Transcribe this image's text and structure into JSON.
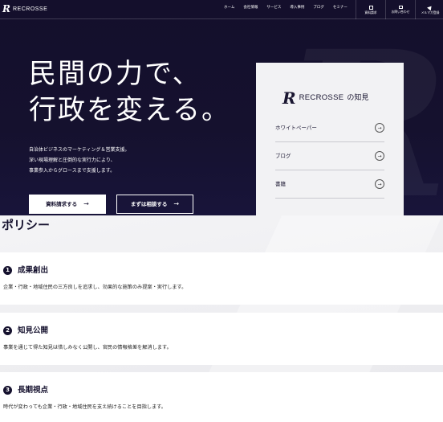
{
  "header": {
    "logo_mark": "R",
    "logo_text": "RECROSSE",
    "nav": [
      "ホーム",
      "会社情報",
      "サービス",
      "導入事例",
      "ブログ",
      "セミナー"
    ],
    "utilities": [
      {
        "label": "資料請求",
        "icon": "document-icon"
      },
      {
        "label": "お問い合わせ",
        "icon": "mail-icon"
      },
      {
        "label": "メルマガ登録",
        "icon": "send-icon"
      }
    ]
  },
  "hero": {
    "headline": [
      "民間の力で、",
      "行政を変える。"
    ],
    "description": [
      "自治体ビジネスのマーケティング＆営業支援。",
      "深い現場理解と圧倒的な実行力により、",
      "事業参入からグロースまで支援します。"
    ],
    "primary_button": "資料請求する",
    "secondary_button": "まずは相談する",
    "arrow": "→",
    "deco_letter": "R"
  },
  "knowledge": {
    "mark": "R",
    "brand": "RECROSSE",
    "suffix": "の知見",
    "items": [
      "ホワイトペーパー",
      "ブログ",
      "書籍"
    ],
    "arrow": "→"
  },
  "policy": {
    "title": "ポリシー",
    "items": [
      {
        "number": "1",
        "title": "成果創出",
        "text": "企業・行政・地域住民の三方良しを追求し、効果的な施策のみ提案・実行します。"
      },
      {
        "number": "2",
        "title": "知見公開",
        "text": "事業を通じて得た知見は惜しみなく公開し、官民の情報格差を解消します。"
      },
      {
        "number": "3",
        "title": "長期視点",
        "text": "時代が変わっても企業・行政・地域住民を支え続けることを目指します。"
      }
    ]
  },
  "colors": {
    "navy": "#15112e",
    "white": "#ffffff",
    "panel": "#f2f2f4"
  }
}
